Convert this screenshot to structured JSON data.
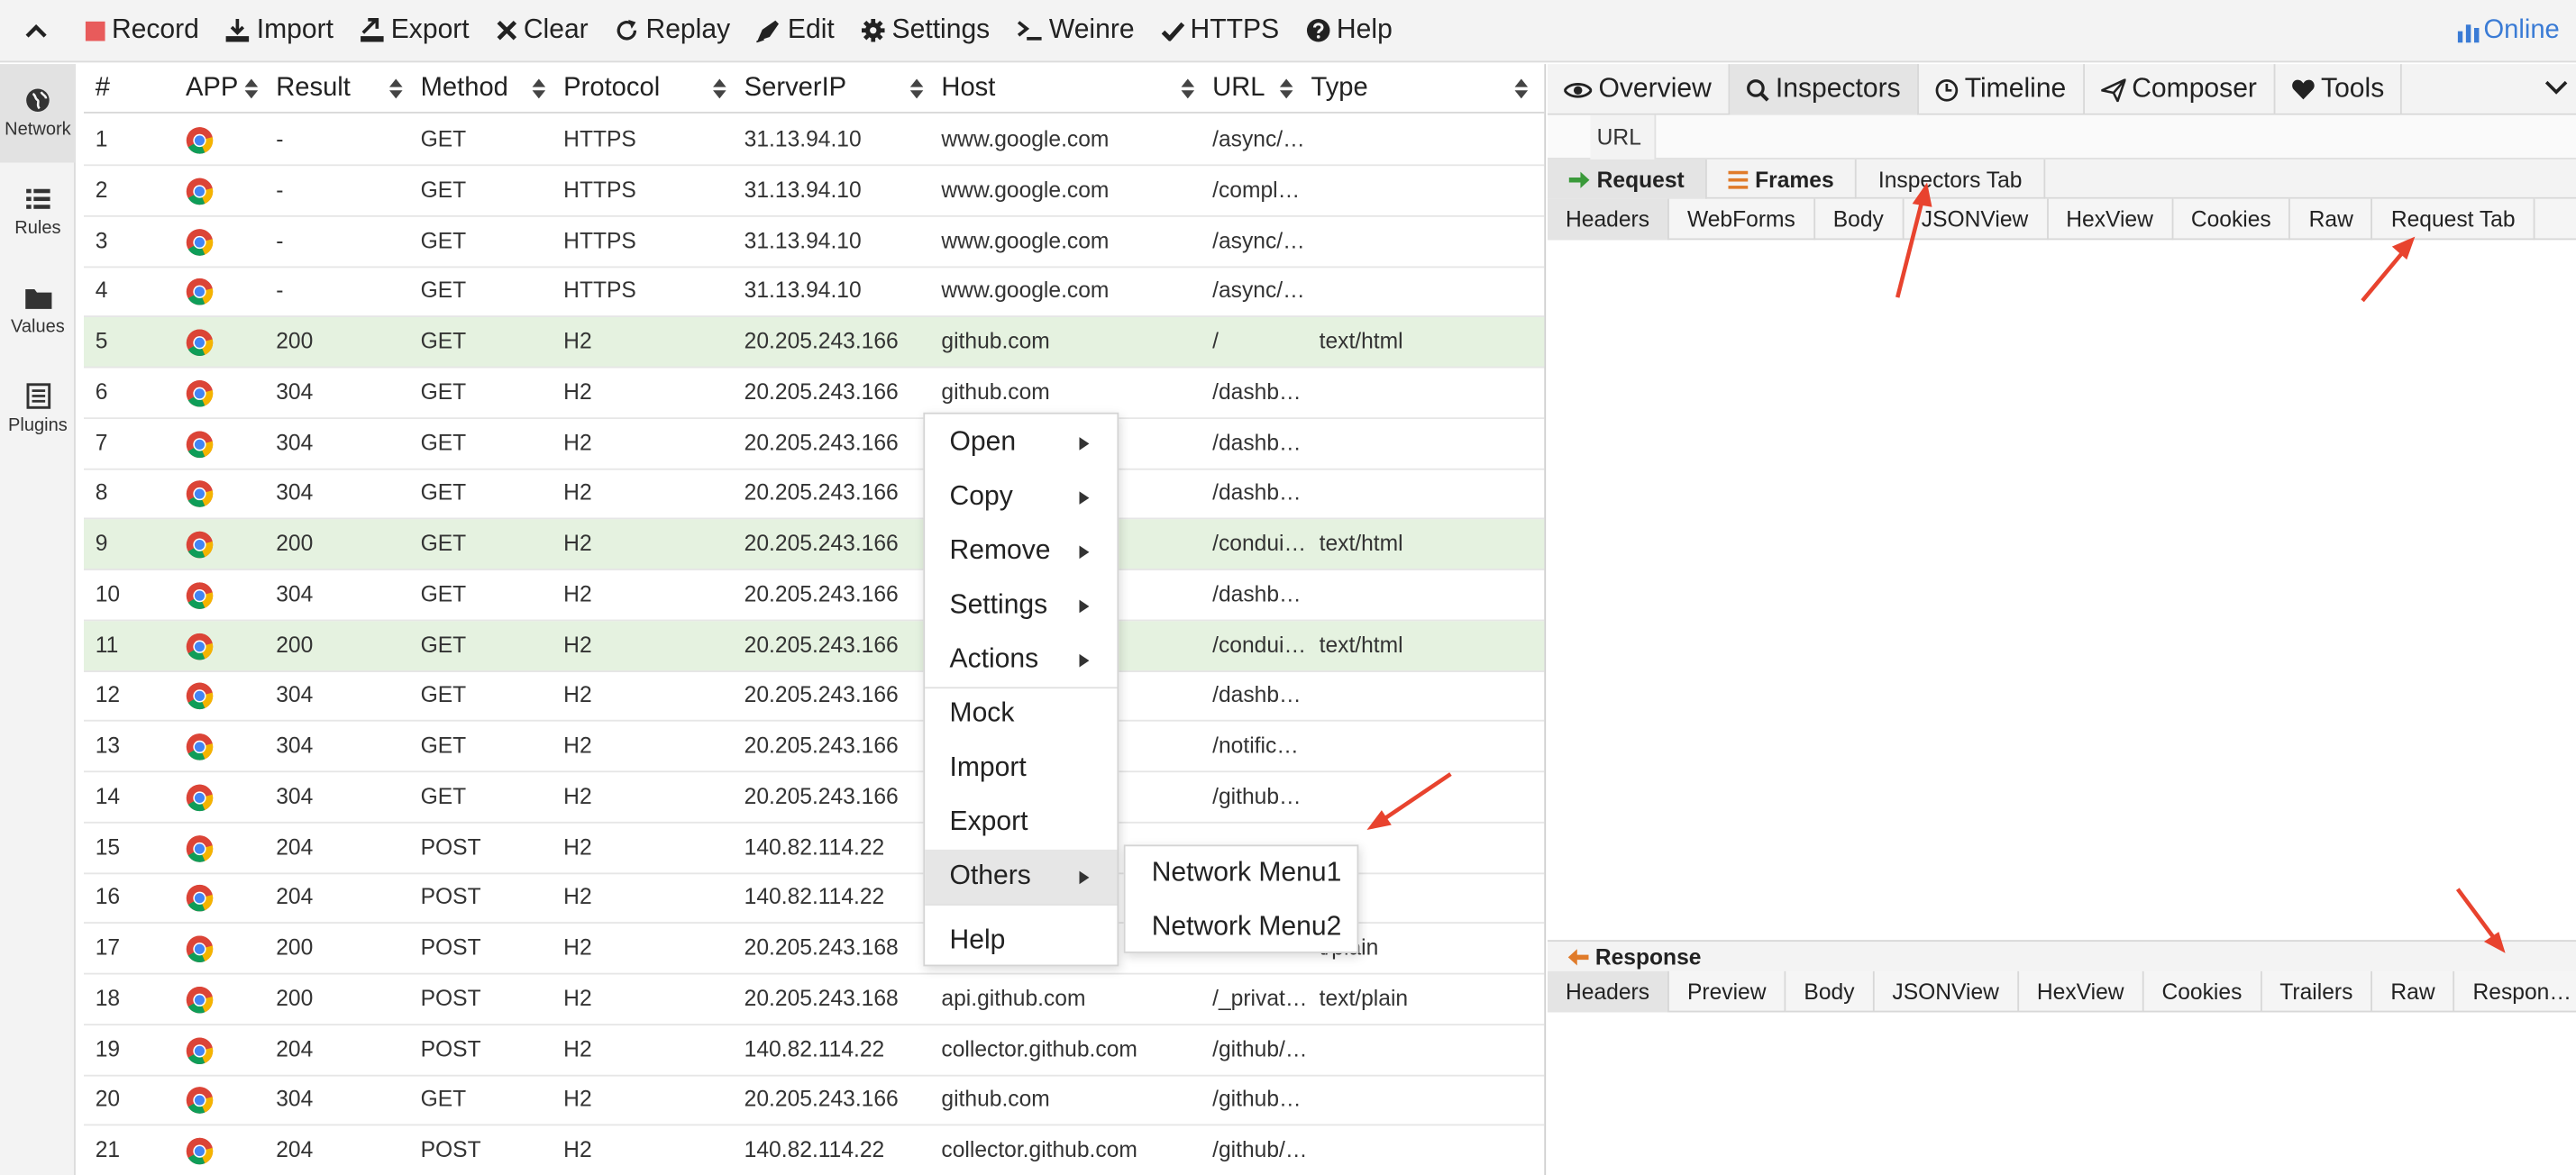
{
  "toolbar": {
    "buttons": [
      {
        "label": "Record",
        "icon": "record-icon"
      },
      {
        "label": "Import",
        "icon": "import-icon"
      },
      {
        "label": "Export",
        "icon": "export-icon"
      },
      {
        "label": "Clear",
        "icon": "clear-icon"
      },
      {
        "label": "Replay",
        "icon": "replay-icon"
      },
      {
        "label": "Edit",
        "icon": "edit-icon"
      },
      {
        "label": "Settings",
        "icon": "gear-icon"
      },
      {
        "label": "Weinre",
        "icon": "terminal-icon"
      },
      {
        "label": "HTTPS",
        "icon": "check-icon"
      },
      {
        "label": "Help",
        "icon": "help-icon"
      }
    ],
    "online": "Online",
    "colors": {
      "record": "#e85b5b",
      "online": "#3a7bd5"
    }
  },
  "sidebar": {
    "items": [
      {
        "label": "Network",
        "icon": "globe-icon"
      },
      {
        "label": "Rules",
        "icon": "list-icon"
      },
      {
        "label": "Values",
        "icon": "folder-icon"
      },
      {
        "label": "Plugins",
        "icon": "plugin-icon"
      }
    ]
  },
  "network": {
    "columns": [
      "#",
      "APP",
      "Result",
      "Method",
      "Protocol",
      "ServerIP",
      "Host",
      "URL",
      "Type"
    ],
    "rows": [
      {
        "n": "1",
        "result": "-",
        "method": "GET",
        "protocol": "HTTPS",
        "ip": "31.13.94.10",
        "host": "www.google.com",
        "url": "/async/…",
        "type": ""
      },
      {
        "n": "2",
        "result": "-",
        "method": "GET",
        "protocol": "HTTPS",
        "ip": "31.13.94.10",
        "host": "www.google.com",
        "url": "/compl…",
        "type": ""
      },
      {
        "n": "3",
        "result": "-",
        "method": "GET",
        "protocol": "HTTPS",
        "ip": "31.13.94.10",
        "host": "www.google.com",
        "url": "/async/…",
        "type": ""
      },
      {
        "n": "4",
        "result": "-",
        "method": "GET",
        "protocol": "HTTPS",
        "ip": "31.13.94.10",
        "host": "www.google.com",
        "url": "/async/…",
        "type": ""
      },
      {
        "n": "5",
        "result": "200",
        "method": "GET",
        "protocol": "H2",
        "ip": "20.205.243.166",
        "host": "github.com",
        "url": "/",
        "type": "text/html"
      },
      {
        "n": "6",
        "result": "304",
        "method": "GET",
        "protocol": "H2",
        "ip": "20.205.243.166",
        "host": "github.com",
        "url": "/dashb…",
        "type": ""
      },
      {
        "n": "7",
        "result": "304",
        "method": "GET",
        "protocol": "H2",
        "ip": "20.205.243.166",
        "host": "",
        "url": "/dashb…",
        "type": ""
      },
      {
        "n": "8",
        "result": "304",
        "method": "GET",
        "protocol": "H2",
        "ip": "20.205.243.166",
        "host": "",
        "url": "/dashb…",
        "type": ""
      },
      {
        "n": "9",
        "result": "200",
        "method": "GET",
        "protocol": "H2",
        "ip": "20.205.243.166",
        "host": "",
        "url": "/condui…",
        "type": "text/html"
      },
      {
        "n": "10",
        "result": "304",
        "method": "GET",
        "protocol": "H2",
        "ip": "20.205.243.166",
        "host": "",
        "url": "/dashb…",
        "type": ""
      },
      {
        "n": "11",
        "result": "200",
        "method": "GET",
        "protocol": "H2",
        "ip": "20.205.243.166",
        "host": "",
        "url": "/condui…",
        "type": "text/html"
      },
      {
        "n": "12",
        "result": "304",
        "method": "GET",
        "protocol": "H2",
        "ip": "20.205.243.166",
        "host": "",
        "url": "/dashb…",
        "type": ""
      },
      {
        "n": "13",
        "result": "304",
        "method": "GET",
        "protocol": "H2",
        "ip": "20.205.243.166",
        "host": "",
        "url": "/notific…",
        "type": ""
      },
      {
        "n": "14",
        "result": "304",
        "method": "GET",
        "protocol": "H2",
        "ip": "20.205.243.166",
        "host": "",
        "url": "/github…",
        "type": ""
      },
      {
        "n": "15",
        "result": "204",
        "method": "POST",
        "protocol": "H2",
        "ip": "140.82.114.22",
        "host": "",
        "url": "",
        "type": ""
      },
      {
        "n": "16",
        "result": "204",
        "method": "POST",
        "protocol": "H2",
        "ip": "140.82.114.22",
        "host": "",
        "url": "",
        "type": ""
      },
      {
        "n": "17",
        "result": "200",
        "method": "POST",
        "protocol": "H2",
        "ip": "20.205.243.168",
        "host": "",
        "url": "",
        "type": "t/plain"
      },
      {
        "n": "18",
        "result": "200",
        "method": "POST",
        "protocol": "H2",
        "ip": "20.205.243.168",
        "host": "api.github.com",
        "url": "/_privat…",
        "type": "text/plain"
      },
      {
        "n": "19",
        "result": "204",
        "method": "POST",
        "protocol": "H2",
        "ip": "140.82.114.22",
        "host": "collector.github.com",
        "url": "/github/…",
        "type": ""
      },
      {
        "n": "20",
        "result": "304",
        "method": "GET",
        "protocol": "H2",
        "ip": "20.205.243.166",
        "host": "github.com",
        "url": "/github…",
        "type": ""
      },
      {
        "n": "21",
        "result": "204",
        "method": "POST",
        "protocol": "H2",
        "ip": "140.82.114.22",
        "host": "collector.github.com",
        "url": "/github/…",
        "type": ""
      }
    ],
    "colors": {
      "success_row": "#e5f2e0"
    }
  },
  "context_menu": {
    "items": [
      {
        "label": "Open",
        "submenu": true
      },
      {
        "label": "Copy",
        "submenu": true
      },
      {
        "label": "Remove",
        "submenu": true
      },
      {
        "label": "Settings",
        "submenu": true
      },
      {
        "label": "Actions",
        "submenu": true
      },
      {
        "label": "Mock",
        "submenu": false
      },
      {
        "label": "Import",
        "submenu": false
      },
      {
        "label": "Export",
        "submenu": false
      },
      {
        "label": "Others",
        "submenu": true,
        "highlighted": true
      },
      {
        "label": "Help",
        "submenu": false
      }
    ],
    "others_submenu": [
      "Network Menu1",
      "Network Menu2"
    ]
  },
  "right_panel": {
    "tabs": [
      {
        "label": "Overview",
        "icon": "eye-icon"
      },
      {
        "label": "Inspectors",
        "icon": "search-icon",
        "active": true
      },
      {
        "label": "Timeline",
        "icon": "clock-icon"
      },
      {
        "label": "Composer",
        "icon": "send-icon"
      },
      {
        "label": "Tools",
        "icon": "heart-icon"
      }
    ],
    "url_label": "URL",
    "sub_tabs": [
      {
        "label": "Request",
        "icon": "arrow-right-icon",
        "active": true
      },
      {
        "label": "Frames",
        "icon": "menu-icon"
      },
      {
        "label": "Inspectors Tab"
      }
    ],
    "request_tabs": [
      "Headers",
      "WebForms",
      "Body",
      "JSONView",
      "HexView",
      "Cookies",
      "Raw",
      "Request Tab"
    ],
    "response_label": "Response",
    "response_tabs": [
      "Headers",
      "Preview",
      "Body",
      "JSONView",
      "HexView",
      "Cookies",
      "Trailers",
      "Raw",
      "Respon…"
    ],
    "colors": {
      "request_arrow": "#3a9a3a",
      "frames_icon": "#e07b2a",
      "response_arrow": "#e07b2a",
      "annotation_arrow": "#e8432e"
    }
  }
}
